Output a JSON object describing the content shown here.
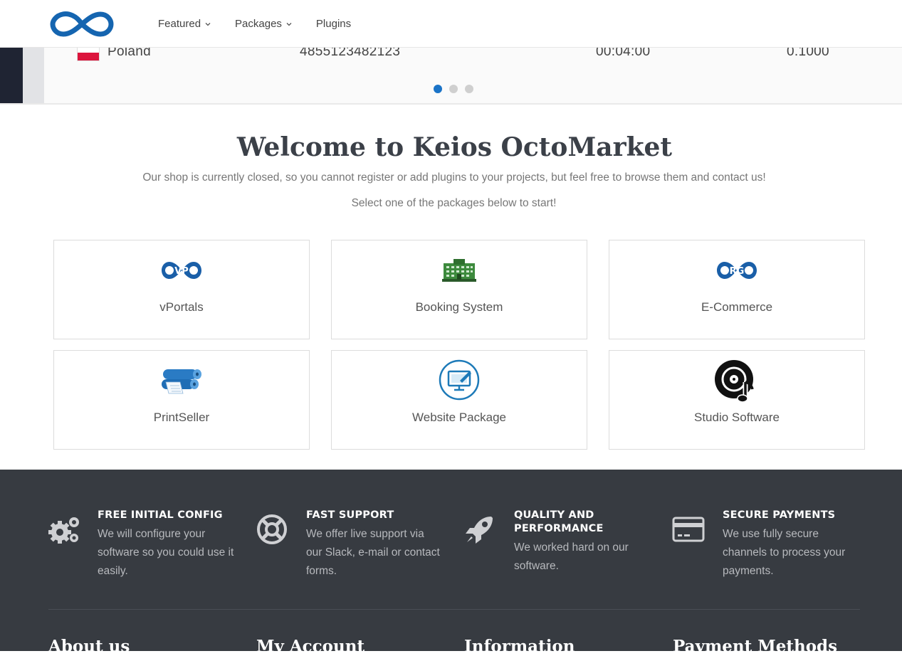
{
  "header": {
    "nav": [
      {
        "label": "Featured",
        "has_dropdown": true
      },
      {
        "label": "Packages",
        "has_dropdown": true
      },
      {
        "label": "Plugins",
        "has_dropdown": false
      }
    ]
  },
  "slider": {
    "row": {
      "country": "Poland",
      "number": "4855123482123",
      "duration": "00:04:00",
      "rate": "0.1000"
    },
    "dots": 3,
    "active_dot": 1
  },
  "welcome": {
    "title": "Welcome to Keios OctoMarket",
    "subtitle": "Our shop is currently closed, so you cannot register or add plugins to your projects, but feel free to browse them and contact us!",
    "instruction": "Select one of the packages below to start!"
  },
  "packages": [
    {
      "label": "vPortals",
      "icon_text": "VP"
    },
    {
      "label": "Booking System"
    },
    {
      "label": "E-Commerce",
      "icon_text": "RG"
    },
    {
      "label": "PrintSeller"
    },
    {
      "label": "Website Package"
    },
    {
      "label": "Studio Software"
    }
  ],
  "features": [
    {
      "title": "FREE INITIAL CONFIG",
      "text": "We will configure your software so you could use it easily.",
      "icon": "gears-icon"
    },
    {
      "title": "FAST SUPPORT",
      "text": "We offer live support via our Slack, e-mail or contact forms.",
      "icon": "lifebuoy-icon"
    },
    {
      "title_line1": "QUALITY AND",
      "title_line2": "PERFORMANCE",
      "text": "We worked hard on our software.",
      "icon": "rocket-icon"
    },
    {
      "title": "SECURE PAYMENTS",
      "text": "We use fully secure channels to process your payments.",
      "icon": "credit-card-icon"
    }
  ],
  "footer": {
    "headings": [
      "About us",
      "My Account",
      "Information",
      "Payment Methods"
    ]
  },
  "colors": {
    "accent": "#1a73c7",
    "dark_band": "#373b41",
    "title": "#3b4048"
  }
}
